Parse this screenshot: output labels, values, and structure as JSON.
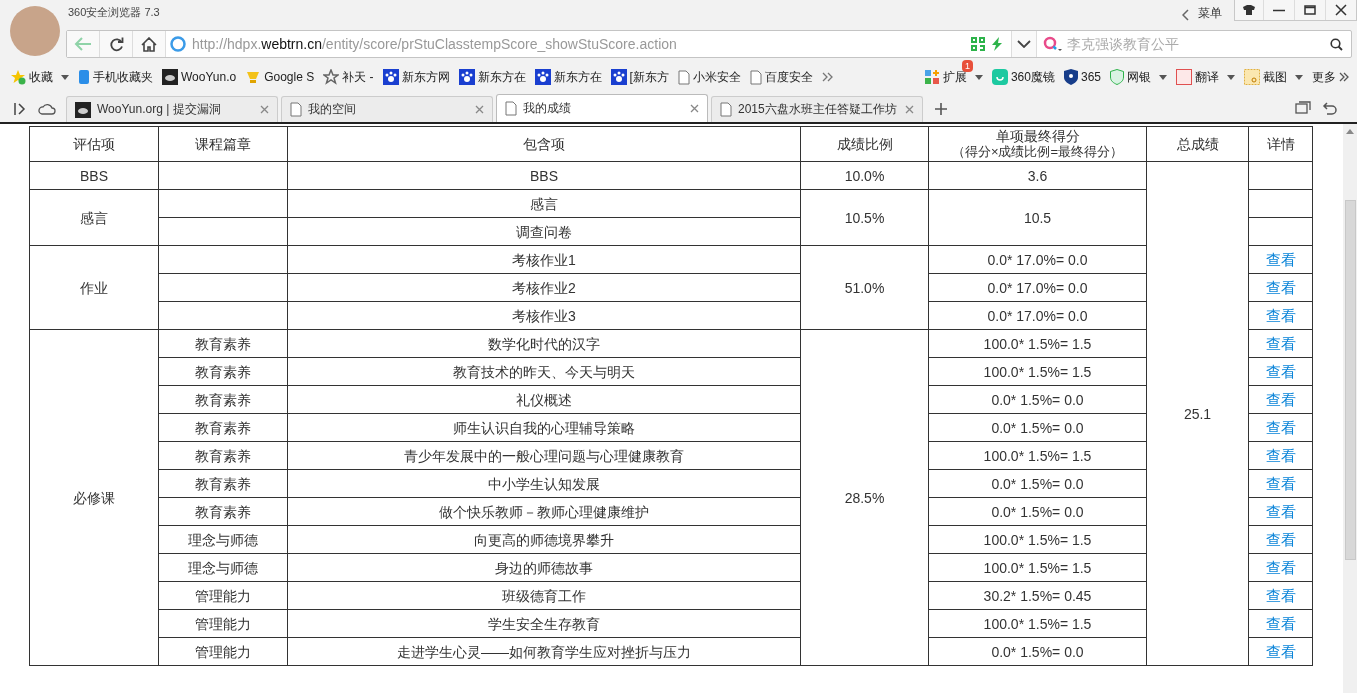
{
  "window": {
    "title": "360安全浏览器 7.3",
    "menu": "菜单"
  },
  "address_bar": {
    "url_prefix": "http://hdpx.",
    "url_domain": "webtrn.cn",
    "url_path": "/entity/score/prStuClasstempScore_showStuScore.action"
  },
  "search": {
    "placeholder": "李克强谈教育公平"
  },
  "bookmarks": [
    {
      "label": "收藏",
      "kind": "star"
    },
    {
      "label": "手机收藏夹",
      "kind": "phone"
    },
    {
      "label": "WooYun.o",
      "kind": "cloud"
    },
    {
      "label": "Google S",
      "kind": "bell"
    },
    {
      "label": "补天 -",
      "kind": "gear"
    },
    {
      "label": "新东方网",
      "kind": "paw"
    },
    {
      "label": "新东方在",
      "kind": "paw"
    },
    {
      "label": "新东方在",
      "kind": "paw"
    },
    {
      "label": "[新东方",
      "kind": "paw"
    },
    {
      "label": "小米安全",
      "kind": "page"
    },
    {
      "label": "百度安全",
      "kind": "page"
    }
  ],
  "extensions": [
    {
      "label": "扩展",
      "badge": "1",
      "kind": "apps"
    },
    {
      "label": "360魔镜",
      "kind": "mirror"
    },
    {
      "label": "365",
      "kind": "shield"
    },
    {
      "label": "网银",
      "kind": "bank"
    },
    {
      "label": "翻译",
      "kind": "translate"
    },
    {
      "label": "截图",
      "kind": "scissors"
    },
    {
      "label": "更多",
      "kind": "more"
    }
  ],
  "tabs": [
    {
      "label": "WooYun.org | 提交漏洞",
      "selected": false,
      "kind": "cloud"
    },
    {
      "label": "我的空间",
      "selected": false,
      "kind": "page"
    },
    {
      "label": "我的成绩",
      "selected": true,
      "kind": "page"
    },
    {
      "label": "2015六盘水班主任答疑工作坊",
      "selected": false,
      "kind": "page"
    }
  ],
  "table": {
    "columns": [
      "评估项",
      "课程篇章",
      "包含项",
      "成绩比例",
      "单项最终得分",
      "（得分×成绩比例=最终得分）",
      "总成绩",
      "详情"
    ],
    "total": "25.1",
    "groups": [
      {
        "item": "BBS",
        "ratio": "10.0%",
        "score": "3.6",
        "rows": [
          {
            "name": "BBS"
          }
        ]
      },
      {
        "item": "感言",
        "ratio": "10.5%",
        "score": "10.5",
        "rows": [
          {
            "name": "感言"
          },
          {
            "name": "调查问卷"
          }
        ]
      },
      {
        "item": "作业",
        "ratio": "51.0%",
        "rows": [
          {
            "name": "考核作业1",
            "score": "0.0* 17.0%= 0.0",
            "detail": "查看"
          },
          {
            "name": "考核作业2",
            "score": "0.0* 17.0%= 0.0",
            "detail": "查看"
          },
          {
            "name": "考核作业3",
            "score": "0.0* 17.0%= 0.0",
            "detail": "查看"
          }
        ]
      },
      {
        "item": "必修课",
        "ratio": "28.5%",
        "rows": [
          {
            "chapter": "教育素养",
            "name": "数学化时代的汉字",
            "score": "100.0* 1.5%= 1.5",
            "detail": "查看"
          },
          {
            "chapter": "教育素养",
            "name": "教育技术的昨天、今天与明天",
            "score": "100.0* 1.5%= 1.5",
            "detail": "查看"
          },
          {
            "chapter": "教育素养",
            "name": "礼仪概述",
            "score": "0.0* 1.5%= 0.0",
            "detail": "查看"
          },
          {
            "chapter": "教育素养",
            "name": "师生认识自我的心理辅导策略",
            "score": "0.0* 1.5%= 0.0",
            "detail": "查看"
          },
          {
            "chapter": "教育素养",
            "name": "青少年发展中的一般心理问题与心理健康教育",
            "score": "100.0* 1.5%= 1.5",
            "detail": "查看"
          },
          {
            "chapter": "教育素养",
            "name": "中小学生认知发展",
            "score": "0.0* 1.5%= 0.0",
            "detail": "查看"
          },
          {
            "chapter": "教育素养",
            "name": "做个快乐教师－教师心理健康维护",
            "score": "0.0* 1.5%= 0.0",
            "detail": "查看"
          },
          {
            "chapter": "理念与师德",
            "name": "向更高的师德境界攀升",
            "score": "100.0* 1.5%= 1.5",
            "detail": "查看"
          },
          {
            "chapter": "理念与师德",
            "name": "身边的师德故事",
            "score": "100.0* 1.5%= 1.5",
            "detail": "查看"
          },
          {
            "chapter": "管理能力",
            "name": "班级德育工作",
            "score": "30.2* 1.5%= 0.45",
            "detail": "查看"
          },
          {
            "chapter": "管理能力",
            "name": "学生安全生存教育",
            "score": "100.0* 1.5%= 1.5",
            "detail": "查看"
          },
          {
            "chapter": "管理能力",
            "name": "走进学生心灵——如何教育学生应对挫折与压力",
            "score": "0.0* 1.5%= 0.0",
            "detail": "查看"
          }
        ]
      }
    ]
  }
}
